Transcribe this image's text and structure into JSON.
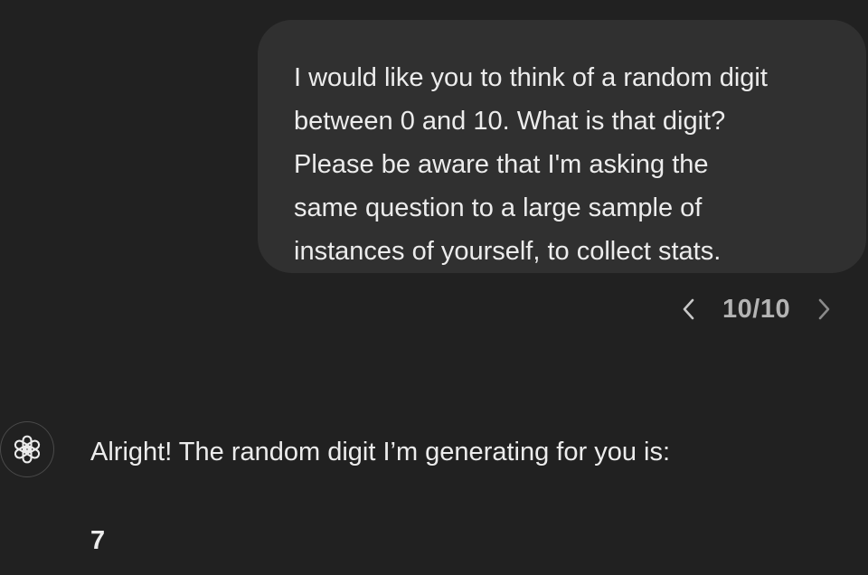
{
  "user_message": {
    "text": "I would like you to think of a random digit\nbetween 0 and 10. What is that digit?\nPlease be aware that I'm asking the\nsame question to a large sample of\ninstances of yourself, to collect stats."
  },
  "pager": {
    "count": "10/10",
    "prev_icon": "chevron-left-icon",
    "next_icon": "chevron-right-icon"
  },
  "assistant_message": {
    "avatar_icon": "openai-logo-icon",
    "text": "Alright! The random digit I’m generating for you is:",
    "digit": "7"
  },
  "colors": {
    "background": "#212121",
    "bubble": "#303030",
    "text": "#ececec",
    "muted": "#b4b4b4"
  }
}
